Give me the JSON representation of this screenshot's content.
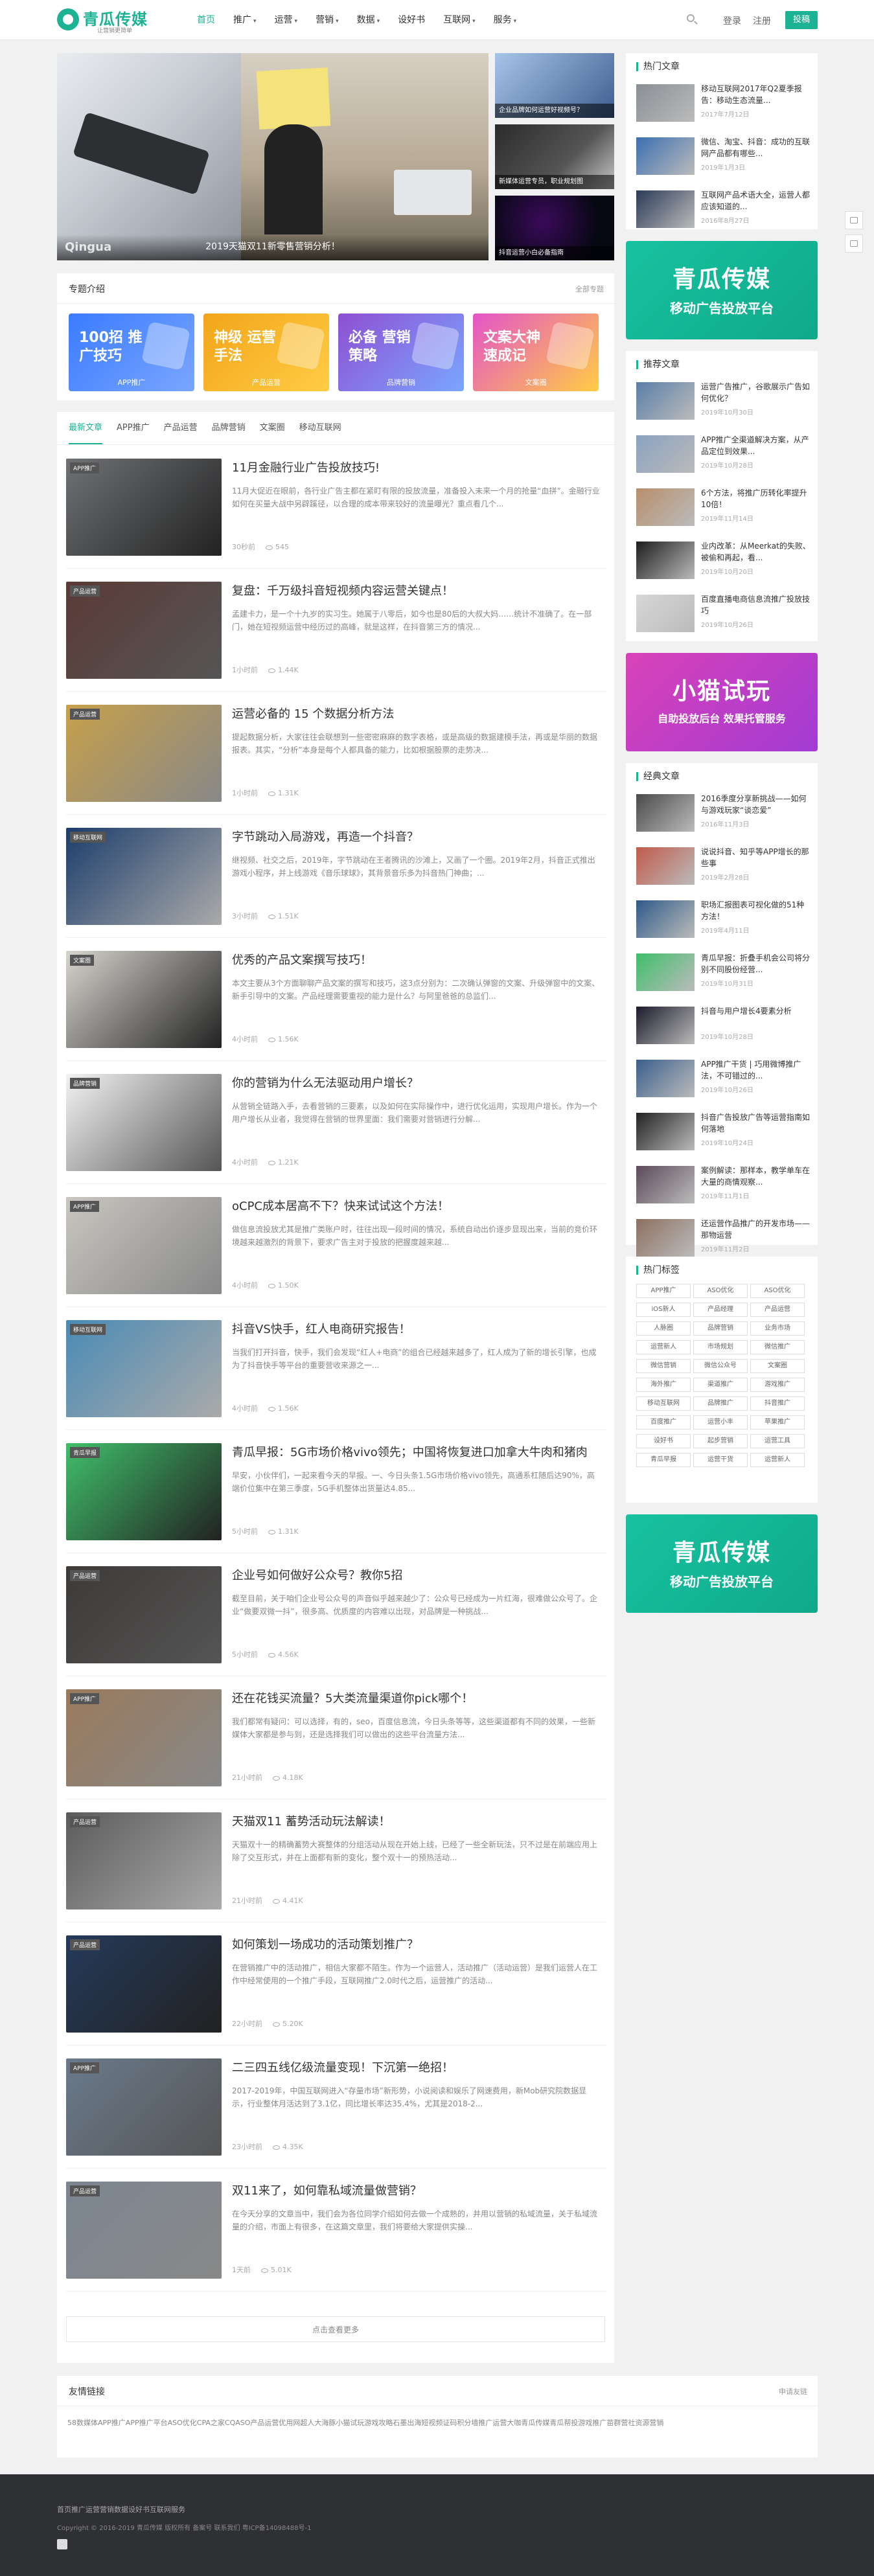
{
  "brand": {
    "name": "青瓜传媒",
    "slogan": "让营销更简单",
    "accent": "#1bb394"
  },
  "nav": {
    "items": [
      {
        "label": "首页",
        "active": true,
        "dropdown": false
      },
      {
        "label": "推广",
        "dropdown": true
      },
      {
        "label": "运营",
        "dropdown": true
      },
      {
        "label": "营销",
        "dropdown": true
      },
      {
        "label": "数据",
        "dropdown": true
      },
      {
        "label": "设好书",
        "dropdown": false
      },
      {
        "label": "互联网",
        "dropdown": true
      },
      {
        "label": "服务",
        "dropdown": true
      }
    ],
    "login": "登录",
    "register": "注册",
    "contribute": "投稿"
  },
  "slider": {
    "main_title": "2019天猫双11新零售营销分析！",
    "watermark": "Qingua",
    "thumbs": [
      {
        "caption": "企业品牌如何运营好视频号？"
      },
      {
        "caption": "新媒体运营专员，职业规划图"
      },
      {
        "caption": "抖音运营小白必备指南"
      }
    ]
  },
  "topic": {
    "title": "专题介绍",
    "more": "全部专题",
    "cards": [
      {
        "big": "100招 推广技巧",
        "tag": "APP推广",
        "color": "#3a7bff"
      },
      {
        "big": "神级 运营手法",
        "tag": "产品运营",
        "color": "#f2a51a"
      },
      {
        "big": "必备 营销策略",
        "tag": "品牌营销",
        "color": "#8e4fd3"
      },
      {
        "big": "文案大神 速成记",
        "tag": "文案圈",
        "color": "#e354c8"
      }
    ]
  },
  "tabs": [
    "最新文章",
    "APP推广",
    "产品运营",
    "品牌营销",
    "文案圈",
    "移动互联网"
  ],
  "posts": [
    {
      "tag": "APP推广",
      "title": "11月金融行业广告投放技巧!",
      "summary": "11月大促近在眼前，各行业广告主都在紧盯有限的投放流量，准备投入未来一个月的抢量“血拼”。金融行业如何在买量大战中另辟蹊径，以合理的成本带来较好的流量曝光？重点看几个...",
      "time": "30秒前",
      "views": "545",
      "bg": "#6f7275"
    },
    {
      "tag": "产品运营",
      "title": "复盘：千万级抖音短视频内容运营关键点！",
      "summary": "孟建卡力，是一个十九岁的实习生。她属于八零后，如今也是80后的大叔大妈……统计不准确了。在一部门，她在短视频运营中经历过的高峰，就是这样，在抖音第三方的情况...",
      "time": "1小时前",
      "views": "1.44K",
      "bg": "#5b3a36"
    },
    {
      "tag": "产品运营",
      "title": "运营必备的 15 个数据分析方法",
      "summary": "提起数据分析，大家往往会联想到一些密密麻麻的数字表格，或是高级的数据建模手法，再或是华丽的数据报表。其实，“分析”本身是每个人都具备的能力，比如根据股票的走势决...",
      "time": "1小时前",
      "views": "1.31K",
      "bg": "#c7a04a"
    },
    {
      "tag": "移动互联网",
      "title": "字节跳动入局游戏，再造一个抖音？",
      "summary": "继视频、社交之后，2019年，字节跳动在王者腾讯的沙滩上，又画了一个圈。2019年2月，抖音正式推出游戏小程序，并上线游戏《音乐球球》，其背景音乐多为抖音热门神曲；...",
      "time": "3小时前",
      "views": "1.51K",
      "bg": "#1c3d6b"
    },
    {
      "tag": "文案圈",
      "title": "优秀的产品文案撰写技巧！",
      "summary": "本文主要从3个方面聊聊产品文案的撰写和技巧，这3点分别为：二次确认弹窗的文案、升级弹窗中的文案、新手引导中的文案。产品经理需要重视的能力是什么？与阿里爸爸的总监们...",
      "time": "4小时前",
      "views": "1.56K",
      "bg": "#d8d5cf"
    },
    {
      "tag": "品牌营销",
      "title": "你的营销为什么无法驱动用户增长？",
      "summary": "从营销全链路入手，去看营销的三要素，以及如何在实际操作中，进行优化运用，实现用户增长。作为一个用户增长从业者，我觉得在营销的世界里面：我们需要对营销进行分解...",
      "time": "4小时前",
      "views": "1.21K",
      "bg": "#f3f3f3"
    },
    {
      "tag": "APP推广",
      "title": "oCPC成本居高不下？快来试试这个方法！",
      "summary": "做信息流投放尤其是推广类账户时，往往出现一段时间的情况，系统自动出价逐步显现出来，当前的竞价环境越来越激烈的背景下，要求广告主对于投放的把握度越来越...",
      "time": "4小时前",
      "views": "1.50K",
      "bg": "#c9c6c0"
    },
    {
      "tag": "移动互联网",
      "title": "抖音VS快手，红人电商研究报告！",
      "summary": "当我们打开抖音，快手，我们会发现“红人+电商”的组合已经越来越多了，红人成为了新的增长引擎，也成为了抖音快手等平台的重要营收来源之一...",
      "time": "4小时前",
      "views": "1.56K",
      "bg": "#4a8bb5"
    },
    {
      "tag": "青瓜早报",
      "title": "青瓜早报：5G市场价格vivo领先；中国将恢复进口加拿大牛肉和猪肉",
      "summary": "早安，小伙伴们，一起来看今天的早报。一、今日头条1.5G市场价格vivo领先，高通系杠随后达90%，高端价位集中在第三季度，5G手机整体出货量达4.85...",
      "time": "5小时前",
      "views": "1.31K",
      "bg": "#3fbf6a"
    },
    {
      "tag": "产品运营",
      "title": "企业号如何做好公众号？教你5招",
      "summary": "截至目前，关于咱们企业号公众号的声音似乎越来越少了：公众号已经成为一片红海，很难做公众号了。企业“做要双微一抖”，很多高、优质度的内容难以出现，对品牌是一种挑战...",
      "time": "5小时前",
      "views": "4.56K",
      "bg": "#3d3a38"
    },
    {
      "tag": "APP推广",
      "title": "还在花钱买流量？5大类流量渠道你pick哪个！",
      "summary": "我们都常有疑问：可以选择，有的，seo，百度信息流，今日头条等等，这些渠道都有不同的效果，一些新媒体大家都是参与到，还是选择我们可以做出的这些平台流量方法...",
      "time": "21小时前",
      "views": "4.18K",
      "bg": "#9a7a5c"
    },
    {
      "tag": "产品运营",
      "title": "天猫双11 蓄势活动玩法解读！",
      "summary": "天猫双十一的精确蓄势大赛整体的分组活动从现在开始上线，已经了一些全新玩法，只不过是在前端应用上除了交互形式，并在上面都有新的变化，整个双十一的预热活动...",
      "time": "21小时前",
      "views": "4.41K",
      "bg": "#5b5b5b"
    },
    {
      "tag": "产品运营",
      "title": "如何策划一场成功的活动策划推广？",
      "summary": "在营销推广中的活动推广，相信大家都不陌生。作为一个运营人，活动推广（活动运营）是我们运营人在工作中经常使用的一个推广手段，互联网推广2.0时代之后，运营推广的活动...",
      "time": "22小时前",
      "views": "5.20K",
      "bg": "#243a5a"
    },
    {
      "tag": "APP推广",
      "title": "二三四五线亿级流量变现！下沉第一绝招！",
      "summary": "2017-2019年，中国互联网进入“存量市场”新形势，小说阅读和娱乐了网速费用，新Mob研究院数据显示，行业整体月活达到了3.1亿，同比增长率达35.4%，尤其是2018-2...",
      "time": "23小时前",
      "views": "4.35K",
      "bg": "#6a7a8c"
    },
    {
      "tag": "产品运营",
      "title": "双11来了，如何靠私域流量做营销？",
      "summary": "在今天分享的文章当中，我们会为各位同学介绍如何去做一个成熟的，并用以营销的私域流量，关于私域流量的介绍，市面上有很多，在这篇文章里，我们将要给大家提供实操...",
      "time": "1天前",
      "views": "5.01K",
      "bg": "#7c8691"
    }
  ],
  "load_more": "点击查看更多",
  "sidebar": {
    "hot": {
      "title": "热门文章",
      "items": [
        {
          "title": "移动互联网2017年Q2夏季报告：移动生态流量...",
          "date": "2017年7月12日",
          "bg": "#8a8f95"
        },
        {
          "title": "微信、淘宝、抖音：成功的互联网产品都有哪些...",
          "date": "2019年1月3日",
          "bg": "#3b6fb2"
        },
        {
          "title": "互联网产品术语大全，运营人都应该知道的...",
          "date": "2016年8月27日",
          "bg": "#2b3a57"
        }
      ]
    },
    "banner1": {
      "big": "青瓜传媒",
      "small": "移动广告投放平台",
      "color": "#17c2a0"
    },
    "recommend": {
      "title": "推荐文章",
      "items": [
        {
          "title": "运营广告推广，谷歌展示广告如何优化？",
          "date": "2019年10月30日",
          "bg": "#5a7fa8"
        },
        {
          "title": "APP推广全渠道解决方案，从产品定位到效果...",
          "date": "2019年10月28日",
          "bg": "#8aa2c0"
        },
        {
          "title": "6个方法，将推广历转化率提升10倍！",
          "date": "2019年11月14日",
          "bg": "#b88f6c"
        },
        {
          "title": "业内改革：从Meerkat的失败、被偷和再起，看...",
          "date": "2019年10月20日",
          "bg": "#1d1d1d"
        },
        {
          "title": "百度直播电商信息流推广投放技巧",
          "date": "2019年10月26日",
          "bg": "#d7d7d7"
        }
      ]
    },
    "banner2": {
      "big": "小猫试玩",
      "small": "自助投放后台 效果托管服务",
      "color": "#d942b8"
    },
    "classic": {
      "title": "经典文章",
      "items": [
        {
          "title": "2016季度分享新挑战——如何与游戏玩家“谈恋爱”",
          "date": "2016年11月3日",
          "bg": "#4a4a4a"
        },
        {
          "title": "说说抖音、知乎等APP增长的那些事",
          "date": "2019年2月28日",
          "bg": "#c25a4a"
        },
        {
          "title": "职场汇报图表可视化做的51种方法！",
          "date": "2019年4月11日",
          "bg": "#2f5a8a"
        },
        {
          "title": "青瓜早报：折叠手机会公司将分别不同股份经营...",
          "date": "2019年10月31日",
          "bg": "#3fbf6a"
        },
        {
          "title": "抖音与用户增长4要素分析",
          "date": "2019年10月28日",
          "bg": "#1b1b2b"
        },
        {
          "title": "APP推广干货 | 巧用微博推广法，不可错过的...",
          "date": "2019年10月26日",
          "bg": "#3a5f8c"
        },
        {
          "title": "抖音广告投放广告等运营指南如何落地",
          "date": "2019年10月24日",
          "bg": "#222"
        },
        {
          "title": "案例解读：那样本，教学单车在大量的商情观察...",
          "date": "2019年11月1日",
          "bg": "#5c4a5a"
        },
        {
          "title": "还运营作品推广的开发市场——那物运营",
          "date": "2019年11月2日",
          "bg": "#8d7060"
        }
      ]
    },
    "tags": {
      "title": "热门标签",
      "items": [
        "APP推广",
        "ASO优化",
        "ASO优化",
        "iOS新人",
        "产品经理",
        "产品运营",
        "人脉圈",
        "品牌营销",
        "业务市场",
        "运营新人",
        "市场规划",
        "微信推广",
        "微信营销",
        "微信公众号",
        "文案圈",
        "海外推广",
        "渠道推广",
        "游戏推广",
        "移动互联网",
        "品牌推广",
        "抖音推广",
        "百度推广",
        "运营小丰",
        "苹果推广",
        "设好书",
        "起步营销",
        "运营工具",
        "青瓜早报",
        "运营干货",
        "运营新人"
      ]
    },
    "banner3": {
      "big": "青瓜传媒",
      "small": "移动广告投放平台",
      "color": "#17c2a0"
    }
  },
  "links": {
    "title": "友情链接",
    "apply": "申请友链",
    "items": [
      "58数媒体",
      "APP推广",
      "APP推广平台",
      "ASO优化",
      "CPA之家",
      "CQASO",
      "产品运营",
      "优用网超人",
      "大海豚",
      "小猫试玩",
      "游戏攻略",
      "石墨出海",
      "短视频证码",
      "积分墙推广",
      "运营大咖",
      "青瓜传媒",
      "青瓜帮投",
      "游戏推广",
      "苗群营社",
      "资源营销"
    ]
  },
  "footer": {
    "nav": [
      "首页",
      "推广",
      "运营",
      "营销",
      "数据",
      "设好书",
      "互联网",
      "服务"
    ],
    "copyright": "Copyright © 2016-2019 青瓜传媒 版权所有 备案号 联系我们 粤ICP备14098488号-1"
  }
}
